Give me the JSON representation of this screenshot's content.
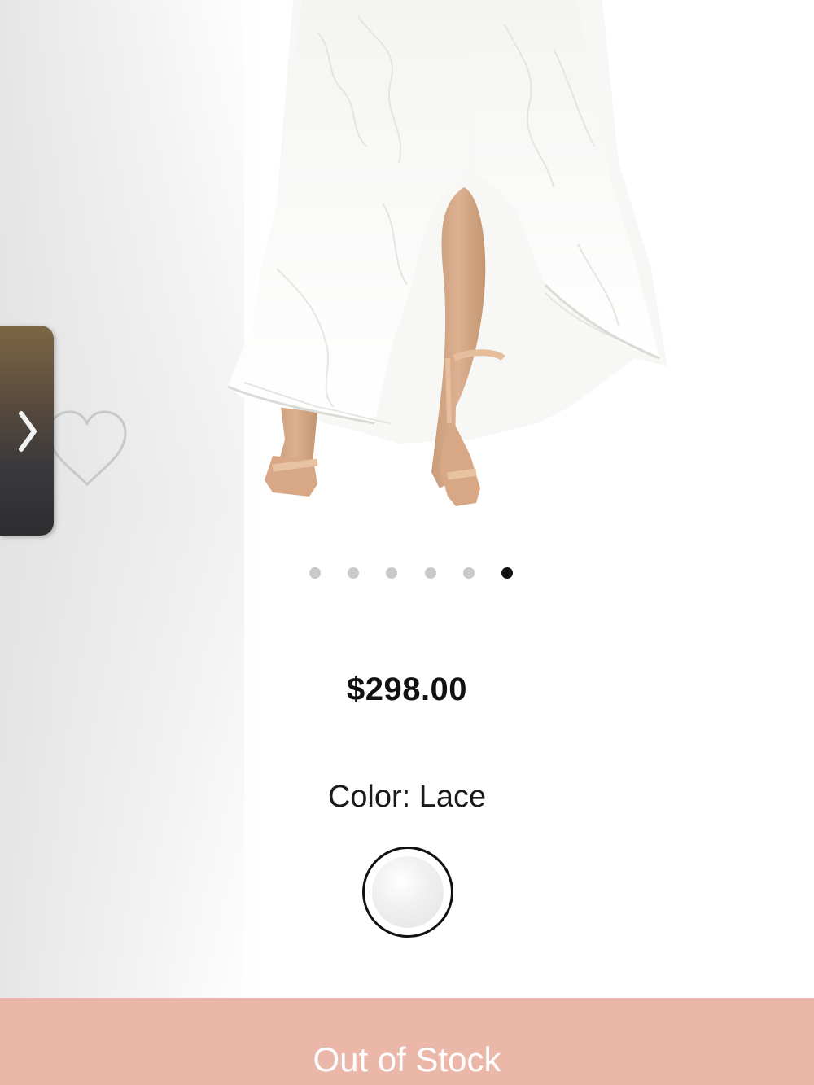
{
  "product": {
    "price": "$298.00",
    "color_label": "Color: Lace",
    "selected_color": "Lace"
  },
  "carousel": {
    "total_images": 6,
    "active_index": 5
  },
  "actions": {
    "cta_label": "Out of Stock"
  },
  "icons": {
    "wishlist": "heart-outline-icon",
    "drawer": "chevron-right-icon"
  },
  "colors": {
    "cta_background": "#eab7a8",
    "active_dot": "#111111",
    "inactive_dot": "#c9c9c9"
  }
}
